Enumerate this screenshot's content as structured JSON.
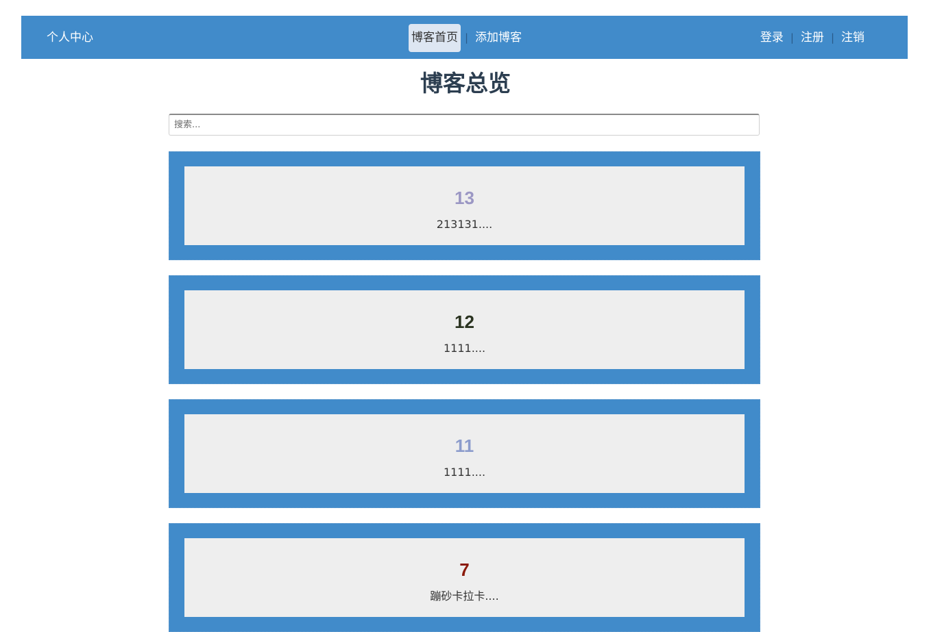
{
  "nav": {
    "personal_center": "个人中心",
    "blog_home": "博客首页",
    "add_blog": "添加博客",
    "login": "登录",
    "register": "注册",
    "logout": "注销",
    "separator": "|"
  },
  "page_title": "博客总览",
  "search": {
    "placeholder": "搜索...",
    "value": ""
  },
  "posts": [
    {
      "title": "13",
      "summary": "213131....",
      "title_color": "#9b97c4"
    },
    {
      "title": "12",
      "summary": "1111....",
      "title_color": "#2a3320"
    },
    {
      "title": "11",
      "summary": "1111....",
      "title_color": "#8c9ccc"
    },
    {
      "title": "7",
      "summary": "蹦砂卡拉卡....",
      "title_color": "#8b1a0a"
    }
  ],
  "colors": {
    "nav_background": "#418bca",
    "card_border": "#418bca",
    "card_background": "#eeeeee",
    "active_nav_background": "#dde6f2"
  }
}
